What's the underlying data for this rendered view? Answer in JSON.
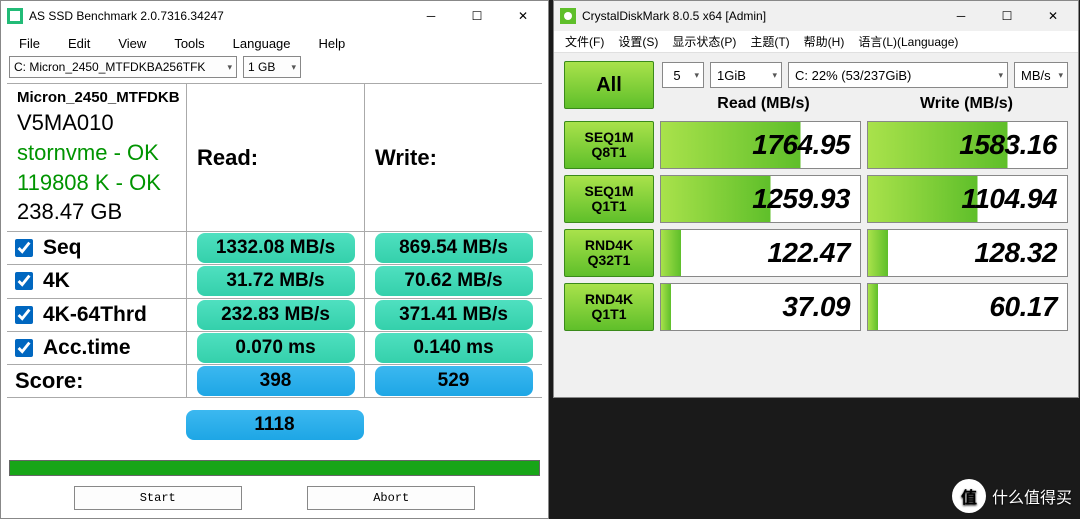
{
  "as": {
    "title": "AS SSD Benchmark 2.0.7316.34247",
    "menus": [
      "File",
      "Edit",
      "View",
      "Tools",
      "Language",
      "Help"
    ],
    "drive_combo": "C: Micron_2450_MTFDKBA256TFK",
    "size_combo": "1 GB",
    "info": {
      "model": "Micron_2450_MTFDKB",
      "fw": "V5MA010",
      "driver": "stornvme - OK",
      "align": "119808 K - OK",
      "capacity": "238.47 GB"
    },
    "head_read": "Read:",
    "head_write": "Write:",
    "tests": [
      {
        "label": "Seq",
        "read": "1332.08 MB/s",
        "write": "869.54 MB/s"
      },
      {
        "label": "4K",
        "read": "31.72 MB/s",
        "write": "70.62 MB/s"
      },
      {
        "label": "4K-64Thrd",
        "read": "232.83 MB/s",
        "write": "371.41 MB/s"
      },
      {
        "label": "Acc.time",
        "read": "0.070 ms",
        "write": "0.140 ms"
      }
    ],
    "score_label": "Score:",
    "score_read": "398",
    "score_write": "529",
    "score_total": "1118",
    "btn_start": "Start",
    "btn_abort": "Abort"
  },
  "cdm": {
    "title": "CrystalDiskMark 8.0.5 x64 [Admin]",
    "menus": [
      "文件(F)",
      "设置(S)",
      "显示状态(P)",
      "主题(T)",
      "帮助(H)",
      "语言(L)(Language)"
    ],
    "all_btn": "All",
    "count": "5",
    "size": "1GiB",
    "drive": "C: 22% (53/237GiB)",
    "unit": "MB/s",
    "head_read": "Read (MB/s)",
    "head_write": "Write (MB/s)",
    "rows": [
      {
        "label": "SEQ1M\nQ8T1",
        "read": "1764.95",
        "write": "1583.16"
      },
      {
        "label": "SEQ1M\nQ1T1",
        "read": "1259.93",
        "write": "1104.94"
      },
      {
        "label": "RND4K\nQ32T1",
        "read": "122.47",
        "write": "128.32"
      },
      {
        "label": "RND4K\nQ1T1",
        "read": "37.09",
        "write": "60.17"
      }
    ]
  },
  "watermark": {
    "badge": "值",
    "text": "什么值得买"
  }
}
